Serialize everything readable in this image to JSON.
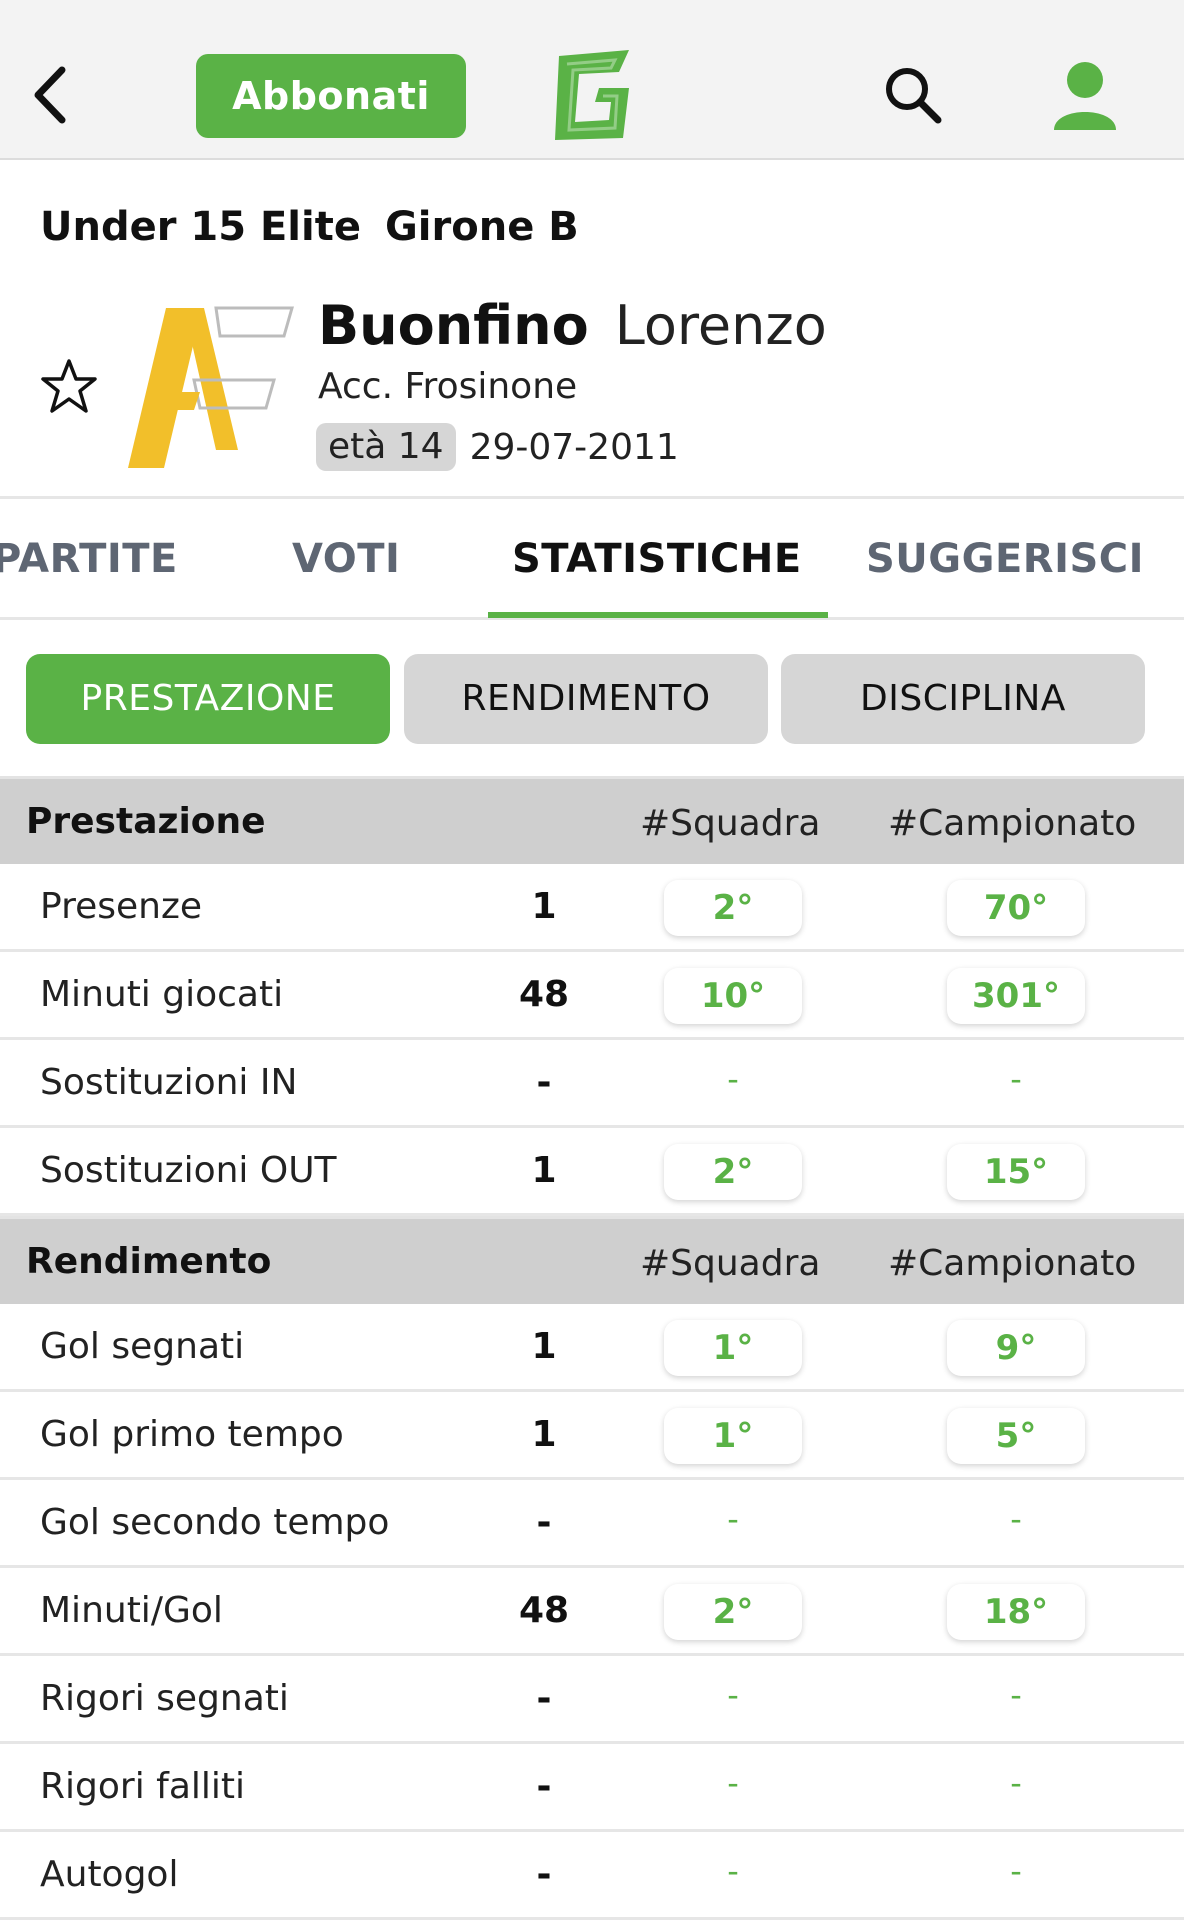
{
  "topbar": {
    "back_icon": "chevron-left-icon",
    "subscribe_label": "Abbonati",
    "logo_letter": "G",
    "search_icon": "search-icon",
    "user_icon": "user-icon",
    "accent_color": "#5ab246"
  },
  "header": {
    "competition": "Under 15 Elite",
    "group": "Girone B",
    "player_surname": "Buonfino",
    "player_firstname": "Lorenzo",
    "team": "Acc. Frosinone",
    "age": "età 14",
    "dob": "29-07-2011",
    "favorite_icon": "star-outline-icon"
  },
  "tabs": [
    {
      "label": "PARTITE",
      "active": false
    },
    {
      "label": "VOTI",
      "active": false
    },
    {
      "label": "STATISTICHE",
      "active": true
    },
    {
      "label": "SUGGERISCI",
      "active": false
    }
  ],
  "segments": [
    {
      "label": "PRESTAZIONE",
      "active": true
    },
    {
      "label": "RENDIMENTO",
      "active": false
    },
    {
      "label": "DISCIPLINA",
      "active": false
    }
  ],
  "sections": [
    {
      "title": "Prestazione",
      "col_team": "#Squadra",
      "col_league": "#Campionato",
      "rows": [
        {
          "label": "Presenze",
          "value": "1",
          "team_rank": "2°",
          "league_rank": "70°"
        },
        {
          "label": "Minuti giocati",
          "value": "48",
          "team_rank": "10°",
          "league_rank": "301°"
        },
        {
          "label": "Sostituzioni IN",
          "value": "-",
          "team_rank": "-",
          "league_rank": "-"
        },
        {
          "label": "Sostituzioni OUT",
          "value": "1",
          "team_rank": "2°",
          "league_rank": "15°"
        }
      ]
    },
    {
      "title": "Rendimento",
      "col_team": "#Squadra",
      "col_league": "#Campionato",
      "rows": [
        {
          "label": "Gol segnati",
          "value": "1",
          "team_rank": "1°",
          "league_rank": "9°"
        },
        {
          "label": "Gol primo tempo",
          "value": "1",
          "team_rank": "1°",
          "league_rank": "5°"
        },
        {
          "label": "Gol secondo tempo",
          "value": "-",
          "team_rank": "-",
          "league_rank": "-"
        },
        {
          "label": "Minuti/Gol",
          "value": "48",
          "team_rank": "2°",
          "league_rank": "18°"
        },
        {
          "label": "Rigori segnati",
          "value": "-",
          "team_rank": "-",
          "league_rank": "-"
        },
        {
          "label": "Rigori falliti",
          "value": "-",
          "team_rank": "-",
          "league_rank": "-"
        },
        {
          "label": "Autogol",
          "value": "-",
          "team_rank": "-",
          "league_rank": "-"
        }
      ]
    }
  ]
}
